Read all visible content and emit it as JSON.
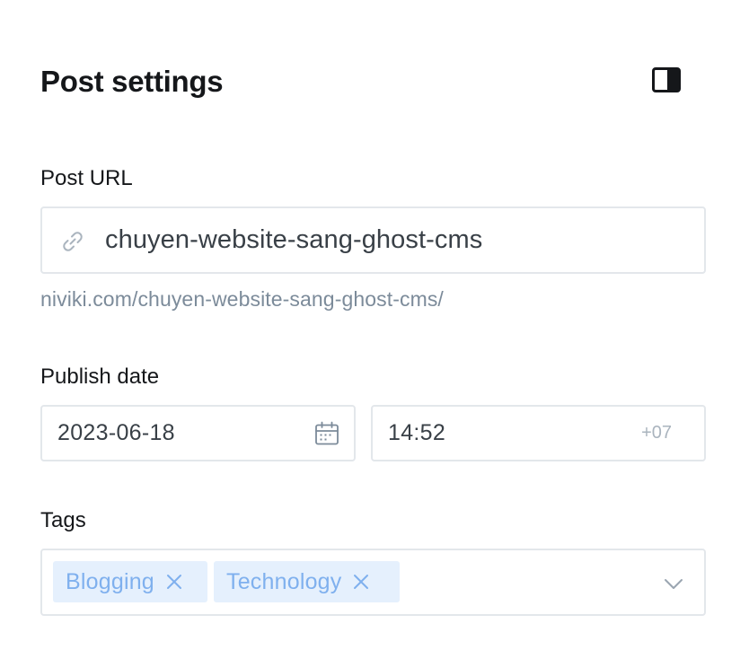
{
  "header": {
    "title": "Post settings",
    "toggle_icon": "sidebar-toggle-icon"
  },
  "post_url": {
    "label": "Post URL",
    "value": "chuyen-website-sang-ghost-cms",
    "hint": "niviki.com/chuyen-website-sang-ghost-cms/",
    "icon": "link-icon"
  },
  "publish_date": {
    "label": "Publish date",
    "date": "2023-06-18",
    "time": "14:52",
    "timezone": "+07",
    "calendar_icon": "calendar-icon"
  },
  "tags": {
    "label": "Tags",
    "items": [
      {
        "label": "Blogging"
      },
      {
        "label": "Technology"
      }
    ],
    "remove_icon": "close-icon",
    "dropdown_icon": "chevron-down-icon"
  },
  "colors": {
    "text": "#15171a",
    "input_text": "#394047",
    "hint": "#7c8b9a",
    "border": "#e3e7eb",
    "tag_bg": "#e5f0fd",
    "tag_text": "#7fb0ee"
  }
}
